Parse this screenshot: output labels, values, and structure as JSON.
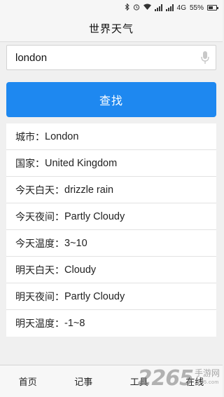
{
  "status_bar": {
    "network": "4G",
    "battery": "55%",
    "battery_level": 0.55,
    "icons": [
      "bluetooth-icon",
      "alarm-icon",
      "wifi-icon",
      "signal-icon",
      "battery-icon"
    ]
  },
  "header": {
    "title": "世界天气"
  },
  "search": {
    "value": "london",
    "placeholder": ""
  },
  "find_button": {
    "label": "查找",
    "color": "#1e88f0"
  },
  "results": [
    {
      "label": "城市：",
      "value": "London"
    },
    {
      "label": "国家：",
      "value": "United Kingdom"
    },
    {
      "label": "今天白天：",
      "value": "drizzle rain"
    },
    {
      "label": "今天夜间：",
      "value": "Partly Cloudy"
    },
    {
      "label": "今天温度：",
      "value": "3~10"
    },
    {
      "label": "明天白天：",
      "value": "Cloudy"
    },
    {
      "label": "明天夜间：",
      "value": "Partly Cloudy"
    },
    {
      "label": "明天温度：",
      "value": "-1~8"
    }
  ],
  "bottom_nav": {
    "items": [
      "首页",
      "记事",
      "工具",
      "在线"
    ]
  },
  "watermark": {
    "digits": "2265",
    "text": "手游网",
    "sub": "2265.com"
  }
}
